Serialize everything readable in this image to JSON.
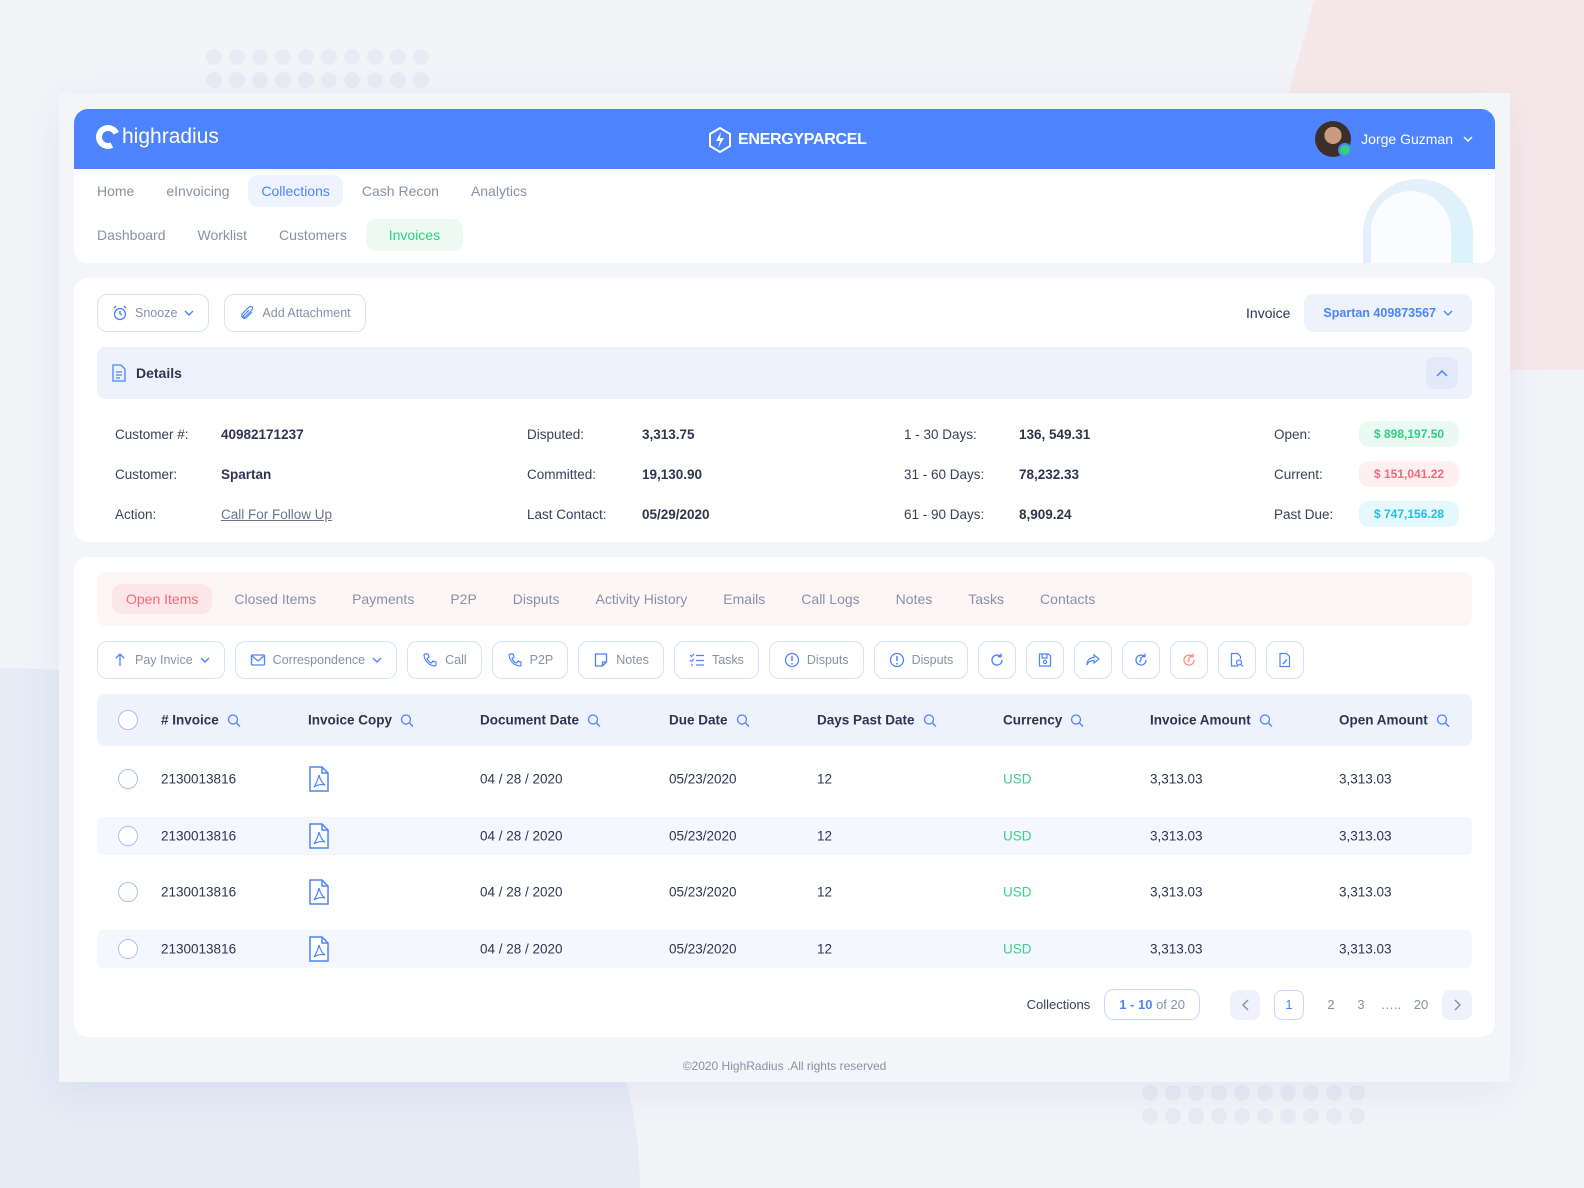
{
  "header": {
    "logo_text": "highradius",
    "brand": "ENERGYPARCEL",
    "user_name": "Jorge Guzman"
  },
  "nav": {
    "primary": [
      "Home",
      "eInvoicing",
      "Collections",
      "Cash Recon",
      "Analytics"
    ],
    "primary_active": "Collections",
    "secondary": [
      "Dashboard",
      "Worklist",
      "Customers",
      "Invoices"
    ],
    "secondary_active": "Invoices"
  },
  "actions": {
    "snooze": "Snooze",
    "add_attachment": "Add Attachment",
    "invoice_label": "Invoice",
    "invoice_value": "Spartan 409873567"
  },
  "details": {
    "title": "Details",
    "customer_no_label": "Customer #:",
    "customer_no": "40982171237",
    "customer_label": "Customer:",
    "customer": "Spartan",
    "action_label": "Action:",
    "action": "Call For Follow Up",
    "disputed_label": "Disputed:",
    "disputed": "3,313.75",
    "committed_label": "Committed:",
    "committed": "19,130.90",
    "last_contact_label": "Last Contact:",
    "last_contact": "05/29/2020",
    "d1_30_label": "1 - 30 Days:",
    "d1_30": "136, 549.31",
    "d31_60_label": "31 - 60 Days:",
    "d31_60": "78,232.33",
    "d61_90_label": "61 - 90 Days:",
    "d61_90": "8,909.24",
    "open_label": "Open:",
    "open": "$ 898,197.50",
    "current_label": "Current:",
    "current": "$ 151,041.22",
    "past_due_label": "Past Due:",
    "past_due": "$ 747,156.28"
  },
  "colors": {
    "primary": "#4d84fd",
    "green": "#2fcf83",
    "red": "#f46b7a",
    "cyan": "#1fbfe8"
  },
  "tabs": [
    "Open Items",
    "Closed Items",
    "Payments",
    "P2P",
    "Disputs",
    "Activity History",
    "Emails",
    "Call Logs",
    "Notes",
    "Tasks",
    "Contacts"
  ],
  "tabs_active": "Open Items",
  "toolbar": [
    {
      "label": "Pay Invice",
      "icon": "arrow-up-icon",
      "dropdown": true
    },
    {
      "label": "Correspondence",
      "icon": "mail-icon",
      "dropdown": true
    },
    {
      "label": "Call",
      "icon": "phone-icon"
    },
    {
      "label": "P2P",
      "icon": "phone-icon"
    },
    {
      "label": "Notes",
      "icon": "note-icon"
    },
    {
      "label": "Tasks",
      "icon": "checklist-icon"
    },
    {
      "label": "Disputs",
      "icon": "alert-circle-icon"
    },
    {
      "label": "Disputs",
      "icon": "alert-circle-icon"
    }
  ],
  "toolbar_icons": [
    "refresh-icon",
    "save-icon",
    "share-icon",
    "history-icon",
    "history-red-icon",
    "document-search-icon",
    "document-edit-icon"
  ],
  "table": {
    "columns": [
      "# Invoice",
      "Invoice Copy",
      "Document Date",
      "Due Date",
      "Days Past Date",
      "Currency",
      "Invoice Amount",
      "Open Amount"
    ],
    "rows": [
      {
        "invoice": "2130013816",
        "doc_date": "04 / 28 / 2020",
        "due_date": "05/23/2020",
        "days": "12",
        "currency": "USD",
        "invoice_amount": "3,313.03",
        "open_amount": "3,313.03"
      },
      {
        "invoice": "2130013816",
        "doc_date": "04 / 28 / 2020",
        "due_date": "05/23/2020",
        "days": "12",
        "currency": "USD",
        "invoice_amount": "3,313.03",
        "open_amount": "3,313.03"
      },
      {
        "invoice": "2130013816",
        "doc_date": "04 / 28 / 2020",
        "due_date": "05/23/2020",
        "days": "12",
        "currency": "USD",
        "invoice_amount": "3,313.03",
        "open_amount": "3,313.03"
      },
      {
        "invoice": "2130013816",
        "doc_date": "04 / 28 / 2020",
        "due_date": "05/23/2020",
        "days": "12",
        "currency": "USD",
        "invoice_amount": "3,313.03",
        "open_amount": "3,313.03"
      }
    ]
  },
  "pagination": {
    "label": "Collections",
    "range": "1 - 10",
    "of": "of 20",
    "pages": [
      "1",
      "2",
      "3",
      "…..",
      "20"
    ],
    "current": "1"
  },
  "footer": "©2020 HighRadius .All rights reserved"
}
